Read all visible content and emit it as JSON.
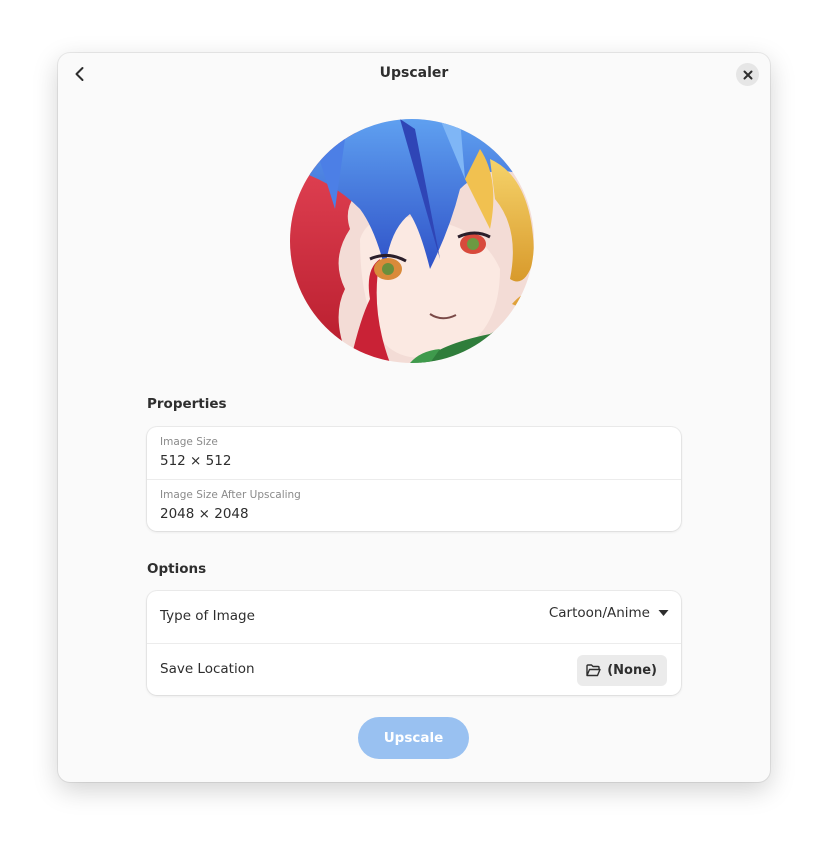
{
  "window": {
    "title": "Upscaler"
  },
  "headerbar": {
    "back_icon": "go-back-icon",
    "close_icon": "window-close-icon"
  },
  "preview": {
    "image": "anime-portrait-artwork"
  },
  "properties": {
    "heading": "Properties",
    "items": [
      {
        "label": "Image Size",
        "value": "512 × 512"
      },
      {
        "label": "Image Size After Upscaling",
        "value": "2048 × 2048"
      }
    ]
  },
  "options": {
    "heading": "Options",
    "type_of_image": {
      "label": "Type of Image",
      "value": "Cartoon/Anime",
      "icon": "pan-down-icon"
    },
    "save_location": {
      "label": "Save Location",
      "button_label": "(None)",
      "icon": "folder-open-icon"
    }
  },
  "actions": {
    "upscale_label": "Upscale"
  },
  "colors": {
    "window_bg": "#fafafa",
    "card_bg": "#ffffff",
    "accent_disabled": "#99c1f1",
    "text": "#2e2e2e",
    "dim_text": "#8a8a8a"
  }
}
